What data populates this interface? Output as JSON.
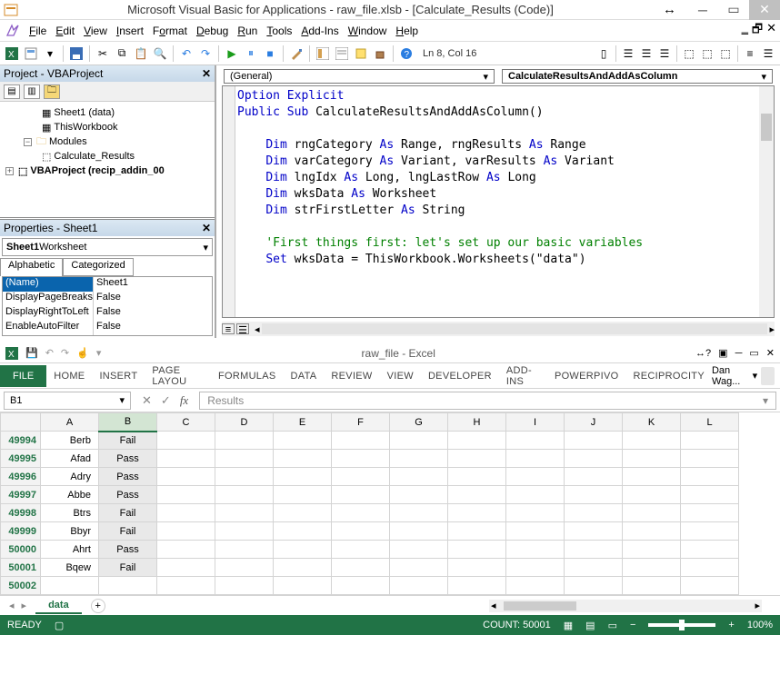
{
  "vba": {
    "title": "Microsoft Visual Basic for Applications - raw_file.xlsb - [Calculate_Results (Code)]",
    "menus": {
      "file": "File",
      "edit": "Edit",
      "view": "View",
      "insert": "Insert",
      "format": "Format",
      "debug": "Debug",
      "run": "Run",
      "tools": "Tools",
      "addins": "Add-Ins",
      "window": "Window",
      "help": "Help"
    },
    "cursor": "Ln 8, Col 16",
    "project_header": "Project - VBAProject",
    "tree": {
      "sheet1": "Sheet1 (data)",
      "thiswb": "ThisWorkbook",
      "modules": "Modules",
      "mod1": "Calculate_Results",
      "root": "VBAProject (recip_addin_00"
    },
    "properties_header": "Properties - Sheet1",
    "prop_combo": {
      "bold": "Sheet1",
      "rest": " Worksheet"
    },
    "prop_tabs": {
      "alpha": "Alphabetic",
      "cat": "Categorized"
    },
    "props": [
      {
        "k": "(Name)",
        "v": "Sheet1",
        "sel": true
      },
      {
        "k": "DisplayPageBreaks",
        "v": "False"
      },
      {
        "k": "DisplayRightToLeft",
        "v": "False"
      },
      {
        "k": "EnableAutoFilter",
        "v": "False"
      }
    ],
    "code_left_combo": "(General)",
    "code_right_combo": "CalculateResultsAndAddAsColumn",
    "code": {
      "l1": "Option Explicit",
      "l2a": "Public Sub",
      "l2b": " CalculateResultsAndAddAsColumn()",
      "l3a": "Dim",
      "l3b": " rngCategory ",
      "l3c": "As",
      "l3d": " Range, rngResults ",
      "l3e": "As",
      "l3f": " Range",
      "l4a": "Dim",
      "l4b": " varCategory ",
      "l4c": "As",
      "l4d": " Variant, varResults ",
      "l4e": "As",
      "l4f": " Variant",
      "l5a": "Dim",
      "l5b": " lngIdx ",
      "l5c": "As",
      "l5d": " Long, lngLastRow ",
      "l5e": "As",
      "l5f": " Long",
      "l6a": "Dim",
      "l6b": " wksData ",
      "l6c": "As",
      "l6d": " Worksheet",
      "l7a": "Dim",
      "l7b": " strFirstLetter ",
      "l7c": "As",
      "l7d": " String",
      "l8": "'First things first: let's set up our basic variables",
      "l9a": "Set",
      "l9b": " wksData = ThisWorkbook.Worksheets(\"data\")"
    }
  },
  "excel": {
    "title": "raw_file - Excel",
    "ribbon": {
      "file": "FILE",
      "home": "HOME",
      "insert": "INSERT",
      "pagelayout": "PAGE LAYOU",
      "formulas": "FORMULAS",
      "data": "DATA",
      "review": "REVIEW",
      "view": "VIEW",
      "developer": "DEVELOPER",
      "addins": "ADD-INS",
      "powerpivo": "POWERPIVO",
      "reciprocity": "RECIPROCITY"
    },
    "user": "Dan Wag...",
    "namebox": "B1",
    "formula": "Results",
    "columns": [
      "A",
      "B",
      "C",
      "D",
      "E",
      "F",
      "G",
      "H",
      "I",
      "J",
      "K",
      "L"
    ],
    "rows": [
      {
        "r": "49994",
        "a": "Berb",
        "b": "Fail"
      },
      {
        "r": "49995",
        "a": "Afad",
        "b": "Pass"
      },
      {
        "r": "49996",
        "a": "Adry",
        "b": "Pass"
      },
      {
        "r": "49997",
        "a": "Abbe",
        "b": "Pass"
      },
      {
        "r": "49998",
        "a": "Btrs",
        "b": "Fail"
      },
      {
        "r": "49999",
        "a": "Bbyr",
        "b": "Fail"
      },
      {
        "r": "50000",
        "a": "Ahrt",
        "b": "Pass"
      },
      {
        "r": "50001",
        "a": "Bqew",
        "b": "Fail"
      }
    ],
    "lastrow": "50002",
    "sheet_tab": "data",
    "status_ready": "READY",
    "status_count": "COUNT: 50001",
    "zoom": "100%"
  }
}
